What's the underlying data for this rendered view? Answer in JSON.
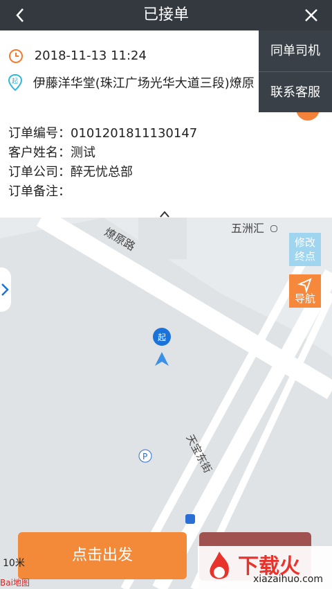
{
  "header": {
    "title": "已接单"
  },
  "order": {
    "time": "2018-11-13 11:24",
    "address": "伊藤洋华堂(珠江广场光华大道三段)燎原",
    "number_label": "订单编号：",
    "number": "0101201811130147",
    "customer_label": "客户姓名：",
    "customer": "测试",
    "company_label": "订单公司：",
    "company": "醉无忧总部",
    "remark_label": "订单备注：",
    "remark": ""
  },
  "menu": {
    "items": [
      "同单司机",
      "联系客服"
    ]
  },
  "map": {
    "labels": {
      "road1": "燎原路",
      "road2": "天宝东街",
      "poi": "五洲汇"
    },
    "buttons": {
      "modify_line1": "修改",
      "modify_line2": "终点",
      "navigate": "导航"
    },
    "scale": "10米",
    "baidu": "Bai地图"
  },
  "actions": {
    "depart": "点击出发"
  },
  "watermark": {
    "brand": "下载火",
    "site": "xiazaihuo.com"
  },
  "colors": {
    "header": "#34393f",
    "accent": "#f28a3a",
    "map_bg": "#e8ebee"
  }
}
